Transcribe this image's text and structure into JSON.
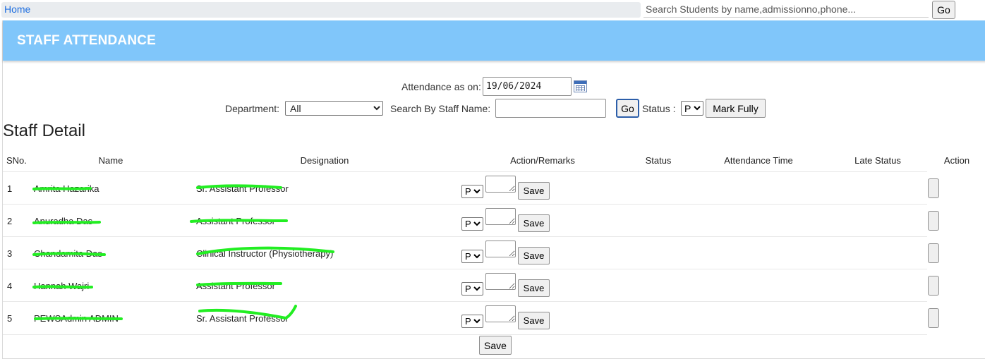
{
  "nav": {
    "home_label": "Home",
    "search_placeholder": "Search Students by name,admissionno,phone...",
    "search_button": "Go"
  },
  "panel": {
    "title": "STAFF ATTENDANCE"
  },
  "filters": {
    "attendance_label": "Attendance as on:",
    "attendance_date": "19/06/2024",
    "department_label": "Department:",
    "department_selected": "All",
    "staff_name_label": "Search By Staff Name:",
    "staff_name_value": "",
    "go_label": "Go",
    "status_label": "Status :",
    "status_selected": "P",
    "mark_fully_label": "Mark Fully"
  },
  "section_title": "Staff Detail",
  "table": {
    "headers": [
      "SNo.",
      "Name",
      "Designation",
      "Action/Remarks",
      "Status",
      "Attendance Time",
      "Late Status",
      "Action"
    ],
    "save_label": "Save",
    "rows": [
      {
        "sno": "1",
        "name": "Amrita Hazarika",
        "designation": "Sr. Assistant Professor",
        "status_value": "P"
      },
      {
        "sno": "2",
        "name": "Anuradha Das",
        "designation": "Assistant Professor",
        "status_value": "P"
      },
      {
        "sno": "3",
        "name": "Chandamita Das",
        "designation": "Clinical Instructor (Physiotherapy)",
        "status_value": "P"
      },
      {
        "sno": "4",
        "name": "Hannah Wajri",
        "designation": "Assistant Professor",
        "status_value": "P"
      },
      {
        "sno": "5",
        "name": "PEWSAdmin ADMIN",
        "designation": "Sr. Assistant Professor",
        "status_value": "P"
      }
    ]
  },
  "bottom_save_label": "Save",
  "colors": {
    "header_bg": "#80c6fa",
    "link": "#1f6fe0",
    "redaction": "#22ee22"
  }
}
